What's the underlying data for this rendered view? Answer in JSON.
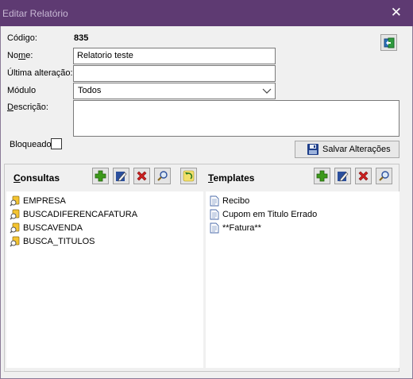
{
  "window": {
    "title": "Editar Relatório",
    "close_glyph": "✕"
  },
  "form": {
    "codigo_label": "Código:",
    "codigo_value": "835",
    "nome_label_prefix": "No",
    "nome_label_underline": "m",
    "nome_label_suffix": "e:",
    "nome_value": "Relatorio teste",
    "ultima_label": "Última alteração:",
    "ultima_value": "",
    "modulo_label": "Módulo",
    "modulo_value": "Todos",
    "descricao_label_underline": "D",
    "descricao_label_suffix": "escrição:",
    "descricao_value": "",
    "bloqueado_label": "Bloqueado",
    "bloqueado_checked": false
  },
  "toolbar": {
    "save_label": "Salvar Alterações"
  },
  "consultas": {
    "title_underline": "C",
    "title_rest": "onsultas",
    "items": [
      {
        "label": "EMPRESA",
        "icon": "query-icon"
      },
      {
        "label": "BUSCADIFERENCAFATURA",
        "icon": "query-icon"
      },
      {
        "label": "BUSCAVENDA",
        "icon": "query-icon"
      },
      {
        "label": "BUSCA_TITULOS",
        "icon": "query-icon"
      }
    ]
  },
  "templates": {
    "title_underline": "T",
    "title_rest": "emplates",
    "items": [
      {
        "label": "Recibo",
        "icon": "document-icon"
      },
      {
        "label": "Cupom em Titulo Errado",
        "icon": "document-icon"
      },
      {
        "label": "**Fatura**",
        "icon": "document-icon"
      }
    ]
  },
  "colors": {
    "titlebar": "#5e3a72",
    "add": "#3c9a1a",
    "delete": "#cc2020"
  }
}
